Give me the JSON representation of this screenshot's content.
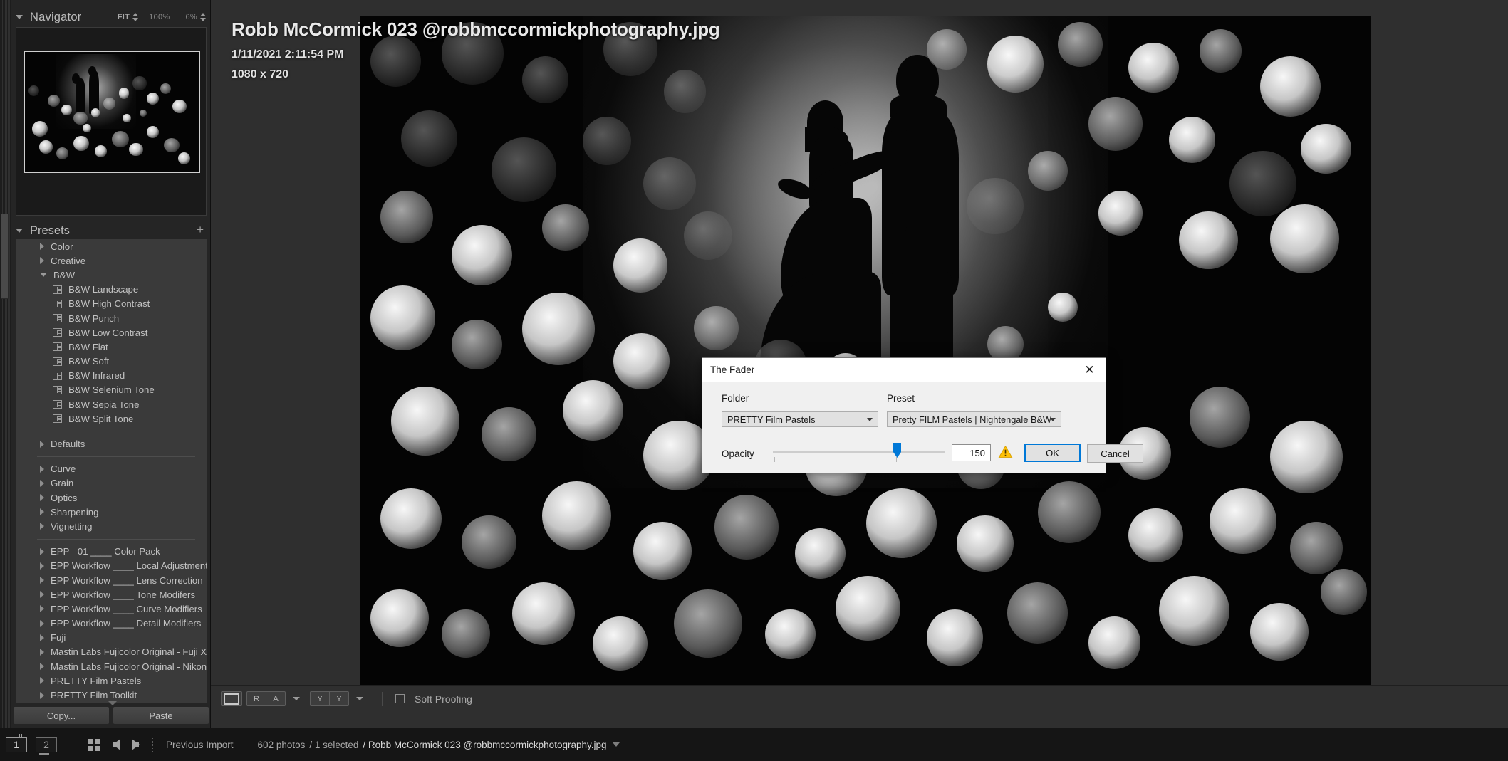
{
  "navigator": {
    "title": "Navigator",
    "fit_label": "FIT",
    "zoom_100": "100%",
    "zoom_current": "6%"
  },
  "presets": {
    "title": "Presets",
    "add_label": "+",
    "groups": [
      {
        "label": "Color",
        "expanded": false
      },
      {
        "label": "Creative",
        "expanded": false
      },
      {
        "label": "B&W",
        "expanded": true,
        "items": [
          "B&W Landscape",
          "B&W High Contrast",
          "B&W Punch",
          "B&W Low Contrast",
          "B&W Flat",
          "B&W Soft",
          "B&W Infrared",
          "B&W Selenium Tone",
          "B&W Sepia Tone",
          "B&W Split Tone"
        ]
      },
      {
        "label": "Defaults",
        "expanded": false
      },
      {
        "label": "Curve",
        "expanded": false
      },
      {
        "label": "Grain",
        "expanded": false
      },
      {
        "label": "Optics",
        "expanded": false
      },
      {
        "label": "Sharpening",
        "expanded": false
      },
      {
        "label": "Vignetting",
        "expanded": false
      },
      {
        "label": "EPP - 01 ____ Color Pack",
        "expanded": false
      },
      {
        "label": "EPP Workflow ____ Local Adjustment Tools",
        "expanded": false
      },
      {
        "label": "EPP Workflow ____ Lens Correction",
        "expanded": false
      },
      {
        "label": "EPP Workflow ____ Tone Modifers",
        "expanded": false
      },
      {
        "label": "EPP Workflow ____ Curve Modifiers",
        "expanded": false
      },
      {
        "label": "EPP Workflow ____ Detail Modifiers",
        "expanded": false
      },
      {
        "label": "Fuji",
        "expanded": false
      },
      {
        "label": "Mastin Labs Fujicolor Original - Fuji X Trans",
        "expanded": false
      },
      {
        "label": "Mastin Labs Fujicolor Original - Nikon",
        "expanded": false
      },
      {
        "label": "PRETTY Film Pastels",
        "expanded": false
      },
      {
        "label": "PRETTY Film Toolkit",
        "expanded": false
      }
    ],
    "copy_label": "Copy...",
    "paste_label": "Paste"
  },
  "photo": {
    "title": "Robb McCormick 023 @robbmccormickphotography.jpg",
    "date": "1/11/2021 2:11:54 PM",
    "dimensions": "1080 x 720"
  },
  "toolbar": {
    "loupe_label": "",
    "compare_r": "R",
    "compare_a": "A",
    "survey_y1": "Y",
    "survey_y2": "Y",
    "soft_proofing_label": "Soft Proofing"
  },
  "bottom_bar": {
    "ident_one": "1",
    "ident_two": "2",
    "source_label": "Previous Import",
    "photo_count": "602 photos",
    "selected_count": "/ 1 selected",
    "current_file": "/ Robb McCormick 023 @robbmccormickphotography.jpg"
  },
  "fader_dialog": {
    "title": "The Fader",
    "close_label": "✕",
    "folder_label": "Folder",
    "folder_value": "PRETTY Film Pastels",
    "preset_label": "Preset",
    "preset_value": "Pretty FILM Pastels | Nightengale B&W",
    "opacity_label": "Opacity",
    "opacity_value": "150",
    "ok_label": "OK",
    "cancel_label": "Cancel",
    "accent_color": "#0078d7",
    "warning_color": "#ffc107"
  }
}
